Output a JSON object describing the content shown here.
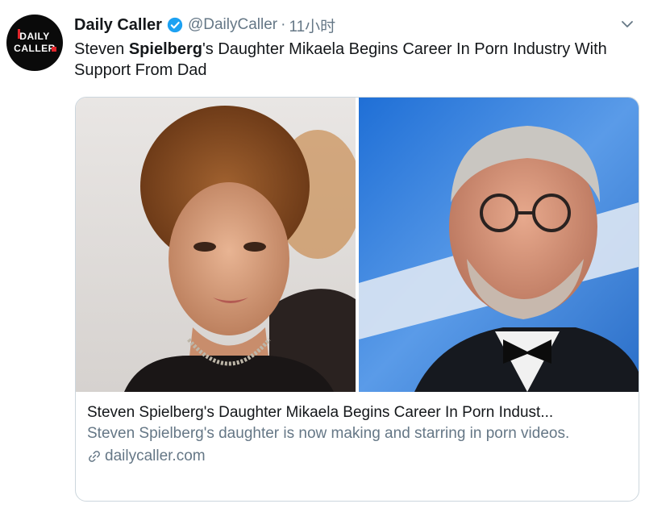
{
  "tweet": {
    "author_name": "Daily Caller",
    "handle": "@DailyCaller",
    "separator": "·",
    "time": "11小时",
    "avatar": {
      "line1": "DAILY",
      "line2": "CALLER"
    },
    "text_parts": [
      {
        "text": "Steven ",
        "bold": false
      },
      {
        "text": "Spielberg",
        "bold": true
      },
      {
        "text": "'s Daughter Mikaela Begins Career In Porn Industry With Support From Dad",
        "bold": false
      }
    ]
  },
  "card": {
    "title": "Steven Spielberg's Daughter Mikaela Begins Career In Porn Indust...",
    "description": "Steven Spielberg's daughter is now making and starring in porn videos.",
    "domain": "dailycaller.com"
  },
  "colors": {
    "verified": "#1da1f2",
    "secondary_text": "#657786",
    "border": "#ccd6dd",
    "logo_red": "#e0252b"
  },
  "icons": {
    "verified": "verified-badge-icon",
    "menu": "chevron-down-icon",
    "link": "link-icon"
  }
}
